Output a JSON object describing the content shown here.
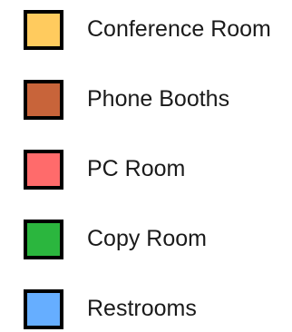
{
  "legend": {
    "items": [
      {
        "label": "Conference Room",
        "color": "#FFCB5E"
      },
      {
        "label": "Phone Booths",
        "color": "#C8643A"
      },
      {
        "label": "PC Room",
        "color": "#FF6B6B"
      },
      {
        "label": "Copy Room",
        "color": "#2BB63E"
      },
      {
        "label": "Restrooms",
        "color": "#66AEFF"
      }
    ]
  }
}
